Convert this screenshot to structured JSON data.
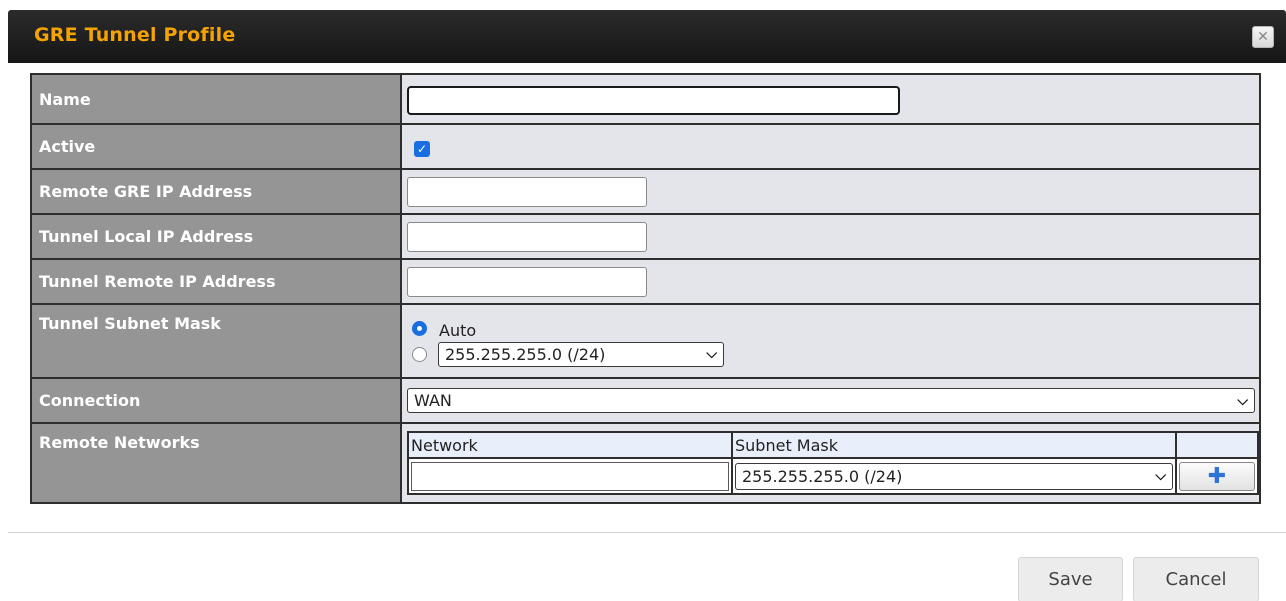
{
  "dialog": {
    "title": "GRE Tunnel Profile",
    "close_icon": "close-icon"
  },
  "fields": {
    "name_label": "Name",
    "name_value": "",
    "active_label": "Active",
    "active_checked": true,
    "remote_gre_label": "Remote GRE IP Address",
    "remote_gre_value": "",
    "tunnel_local_label": "Tunnel Local IP Address",
    "tunnel_local_value": "",
    "tunnel_remote_label": "Tunnel Remote IP Address",
    "tunnel_remote_value": "",
    "subnet_mask_label": "Tunnel Subnet Mask",
    "subnet_auto_label": "Auto",
    "subnet_mask_selected": "255.255.255.0 (/24)",
    "connection_label": "Connection",
    "connection_selected": "WAN",
    "remote_networks_label": "Remote Networks"
  },
  "remote_networks": {
    "col_network": "Network",
    "col_subnet_mask": "Subnet Mask",
    "network_value": "",
    "subnet_mask_selected": "255.255.255.0 (/24)",
    "add_icon": "plus-icon"
  },
  "footer": {
    "save_label": "Save",
    "cancel_label": "Cancel"
  },
  "colors": {
    "title_text": "#f4a300",
    "title_bar": "#1c1c1c",
    "label_bg": "#959595",
    "value_bg": "#e4e4eb",
    "accent": "#1a6fe0"
  }
}
